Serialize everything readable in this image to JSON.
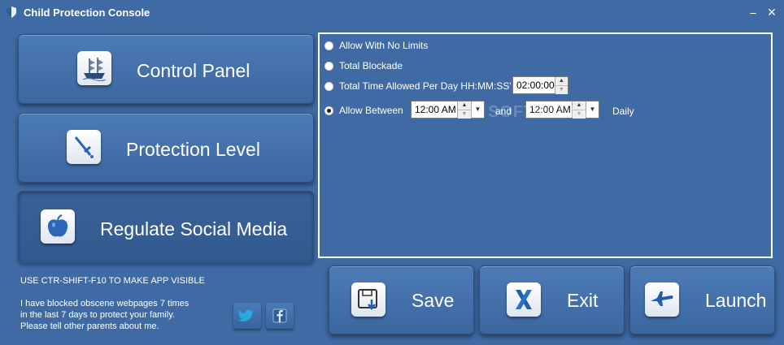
{
  "window": {
    "title": "Child Protection Console",
    "minimize": "⎯",
    "close": "×"
  },
  "nav": {
    "control_panel": "Control Panel",
    "protection_level": "Protection Level",
    "regulate_social_media": "Regulate Social Media"
  },
  "options": {
    "no_limits": "Allow With No Limits",
    "total_blockade": "Total Blockade",
    "time_per_day": "Total Time Allowed Per Day HH:MM:SS'",
    "time_per_day_value": "02:00:00",
    "allow_between": "Allow Between",
    "start_time": "12:00 AM",
    "and": "and",
    "end_time": "12:00 AM",
    "daily": "Daily",
    "selected": "allow_between"
  },
  "watermark": "SOFTPEDIA",
  "actions": {
    "save": "Save",
    "exit": "Exit",
    "launch": "Launch"
  },
  "hint": "USE CTR-SHIFT-F10 TO MAKE APP VISIBLE",
  "note": {
    "line1": "I have blocked obscene webpages 7 times",
    "line2": "in the last 7 days to protect your family.",
    "line3": "Please tell other parents about me."
  },
  "icons": {
    "app": "shield-icon",
    "control_panel": "ship-icon",
    "protection_level": "sword-icon",
    "social_media": "apple-icon",
    "save": "save-icon",
    "exit": "exit-icon",
    "launch": "jet-icon",
    "twitter": "twitter-icon",
    "facebook": "facebook-icon"
  }
}
